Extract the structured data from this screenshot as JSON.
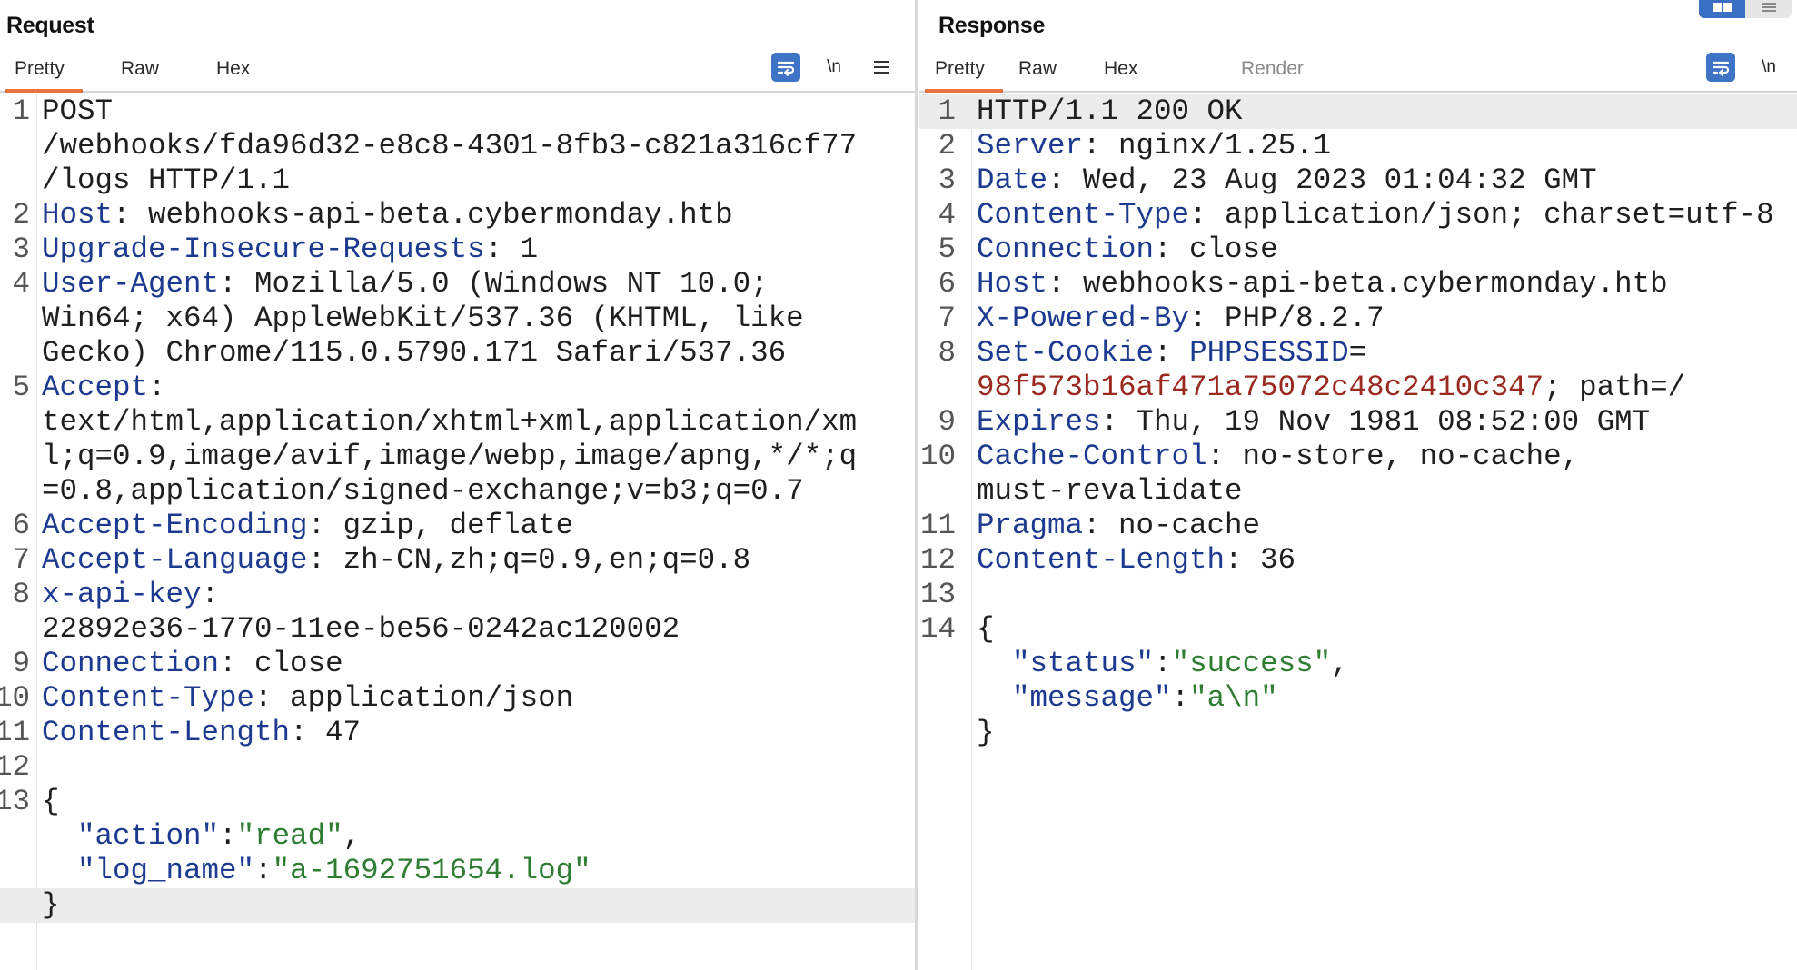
{
  "request": {
    "title": "Request",
    "tabs": [
      {
        "label": "Pretty",
        "active": true
      },
      {
        "label": "Raw",
        "active": false
      },
      {
        "label": "Hex",
        "active": false
      }
    ],
    "toolbar": {
      "wrap_icon": "word-wrap-icon",
      "newline_label": "\\n",
      "menu_icon": "hamburger-menu-icon"
    },
    "lines": [
      {
        "num": "1",
        "segs": [
          {
            "t": "POST",
            "c": "v"
          }
        ]
      },
      {
        "num": "",
        "segs": [
          {
            "t": "/webhooks/fda96d32-e8c8-4301-8fb3-c821a316cf77",
            "c": "v"
          }
        ]
      },
      {
        "num": "",
        "segs": [
          {
            "t": "/logs HTTP/1.1",
            "c": "v"
          }
        ]
      },
      {
        "num": "2",
        "segs": [
          {
            "t": "Host",
            "c": "k"
          },
          {
            "t": ": webhooks-api-beta.cybermonday.htb",
            "c": "v"
          }
        ]
      },
      {
        "num": "3",
        "segs": [
          {
            "t": "Upgrade-Insecure-Requests",
            "c": "k"
          },
          {
            "t": ": 1",
            "c": "v"
          }
        ]
      },
      {
        "num": "4",
        "segs": [
          {
            "t": "User-Agent",
            "c": "k"
          },
          {
            "t": ": Mozilla/5.0 (Windows NT 10.0;",
            "c": "v"
          }
        ]
      },
      {
        "num": "",
        "segs": [
          {
            "t": "Win64; x64) AppleWebKit/537.36 (KHTML, like",
            "c": "v"
          }
        ]
      },
      {
        "num": "",
        "segs": [
          {
            "t": "Gecko) Chrome/115.0.5790.171 Safari/537.36",
            "c": "v"
          }
        ]
      },
      {
        "num": "5",
        "segs": [
          {
            "t": "Accept",
            "c": "k"
          },
          {
            "t": ":",
            "c": "v"
          }
        ]
      },
      {
        "num": "",
        "segs": [
          {
            "t": "text/html,application/xhtml+xml,application/xm",
            "c": "v"
          }
        ]
      },
      {
        "num": "",
        "segs": [
          {
            "t": "l;q=0.9,image/avif,image/webp,image/apng,*/*;q",
            "c": "v"
          }
        ]
      },
      {
        "num": "",
        "segs": [
          {
            "t": "=0.8,application/signed-exchange;v=b3;q=0.7",
            "c": "v"
          }
        ]
      },
      {
        "num": "6",
        "segs": [
          {
            "t": "Accept-Encoding",
            "c": "k"
          },
          {
            "t": ": gzip, deflate",
            "c": "v"
          }
        ]
      },
      {
        "num": "7",
        "segs": [
          {
            "t": "Accept-Language",
            "c": "k"
          },
          {
            "t": ": zh-CN,zh;q=0.9,en;q=0.8",
            "c": "v"
          }
        ]
      },
      {
        "num": "8",
        "segs": [
          {
            "t": "x-api-key",
            "c": "k"
          },
          {
            "t": ":",
            "c": "v"
          }
        ]
      },
      {
        "num": "",
        "segs": [
          {
            "t": "22892e36-1770-11ee-be56-0242ac120002",
            "c": "v"
          }
        ]
      },
      {
        "num": "9",
        "segs": [
          {
            "t": "Connection",
            "c": "k"
          },
          {
            "t": ": close",
            "c": "v"
          }
        ]
      },
      {
        "num": "10",
        "segs": [
          {
            "t": "Content-Type",
            "c": "k"
          },
          {
            "t": ": application/json",
            "c": "v"
          }
        ]
      },
      {
        "num": "11",
        "segs": [
          {
            "t": "Content-Length",
            "c": "k"
          },
          {
            "t": ": 47",
            "c": "v"
          }
        ]
      },
      {
        "num": "12",
        "segs": []
      },
      {
        "num": "13",
        "segs": [
          {
            "t": "{",
            "c": "v"
          }
        ]
      },
      {
        "num": "",
        "segs": [
          {
            "t": "  \"action\"",
            "c": "k"
          },
          {
            "t": ":",
            "c": "v"
          },
          {
            "t": "\"read\"",
            "c": "s"
          },
          {
            "t": ",",
            "c": "v"
          }
        ]
      },
      {
        "num": "",
        "segs": [
          {
            "t": "  \"log_name\"",
            "c": "k"
          },
          {
            "t": ":",
            "c": "v"
          },
          {
            "t": "\"a-1692751654.log\"",
            "c": "s"
          }
        ]
      },
      {
        "num": "",
        "segs": [
          {
            "t": "}",
            "c": "v"
          }
        ],
        "highlight": true
      }
    ]
  },
  "response": {
    "title": "Response",
    "tabs": [
      {
        "label": "Pretty",
        "active": true
      },
      {
        "label": "Raw",
        "active": false
      },
      {
        "label": "Hex",
        "active": false
      },
      {
        "label": "Render",
        "active": false,
        "disabled": true
      }
    ],
    "toolbar": {
      "wrap_icon": "word-wrap-icon",
      "newline_label": "\\n"
    },
    "lines": [
      {
        "num": "1",
        "segs": [
          {
            "t": "HTTP/1.1 200 OK",
            "c": "v"
          }
        ],
        "highlight": true
      },
      {
        "num": "2",
        "segs": [
          {
            "t": "Server",
            "c": "k"
          },
          {
            "t": ": nginx/1.25.1",
            "c": "v"
          }
        ]
      },
      {
        "num": "3",
        "segs": [
          {
            "t": "Date",
            "c": "k"
          },
          {
            "t": ": Wed, 23 Aug 2023 01:04:32 GMT",
            "c": "v"
          }
        ]
      },
      {
        "num": "4",
        "segs": [
          {
            "t": "Content-Type",
            "c": "k"
          },
          {
            "t": ": application/json; charset=utf-8",
            "c": "v"
          }
        ]
      },
      {
        "num": "5",
        "segs": [
          {
            "t": "Connection",
            "c": "k"
          },
          {
            "t": ": close",
            "c": "v"
          }
        ]
      },
      {
        "num": "6",
        "segs": [
          {
            "t": "Host",
            "c": "k"
          },
          {
            "t": ": webhooks-api-beta.cybermonday.htb",
            "c": "v"
          }
        ]
      },
      {
        "num": "7",
        "segs": [
          {
            "t": "X-Powered-By",
            "c": "k"
          },
          {
            "t": ": PHP/8.2.7",
            "c": "v"
          }
        ]
      },
      {
        "num": "8",
        "segs": [
          {
            "t": "Set-Cookie",
            "c": "k"
          },
          {
            "t": ": ",
            "c": "v"
          },
          {
            "t": "PHPSESSID",
            "c": "k"
          },
          {
            "t": "=",
            "c": "v"
          }
        ]
      },
      {
        "num": "",
        "segs": [
          {
            "t": "98f573b16af471a75072c48c2410c347",
            "c": "c"
          },
          {
            "t": "; path=/",
            "c": "v"
          }
        ]
      },
      {
        "num": "9",
        "segs": [
          {
            "t": "Expires",
            "c": "k"
          },
          {
            "t": ": Thu, 19 Nov 1981 08:52:00 GMT",
            "c": "v"
          }
        ]
      },
      {
        "num": "10",
        "segs": [
          {
            "t": "Cache-Control",
            "c": "k"
          },
          {
            "t": ": no-store, no-cache,",
            "c": "v"
          }
        ]
      },
      {
        "num": "",
        "segs": [
          {
            "t": "must-revalidate",
            "c": "v"
          }
        ]
      },
      {
        "num": "11",
        "segs": [
          {
            "t": "Pragma",
            "c": "k"
          },
          {
            "t": ": no-cache",
            "c": "v"
          }
        ]
      },
      {
        "num": "12",
        "segs": [
          {
            "t": "Content-Length",
            "c": "k"
          },
          {
            "t": ": 36",
            "c": "v"
          }
        ]
      },
      {
        "num": "13",
        "segs": []
      },
      {
        "num": "14",
        "segs": [
          {
            "t": "{",
            "c": "v"
          }
        ]
      },
      {
        "num": "",
        "segs": [
          {
            "t": "  \"status\"",
            "c": "k"
          },
          {
            "t": ":",
            "c": "v"
          },
          {
            "t": "\"success\"",
            "c": "s"
          },
          {
            "t": ",",
            "c": "v"
          }
        ]
      },
      {
        "num": "",
        "segs": [
          {
            "t": "  \"message\"",
            "c": "k"
          },
          {
            "t": ":",
            "c": "v"
          },
          {
            "t": "\"a\\n\"",
            "c": "s"
          }
        ]
      },
      {
        "num": "",
        "segs": [
          {
            "t": "}",
            "c": "v"
          }
        ]
      }
    ]
  },
  "layout_toggle": {
    "icons": [
      "split-view-icon",
      "stacked-view-icon"
    ],
    "active": "split-view-icon"
  },
  "colors": {
    "header_key": "#1c3a8f",
    "value_text": "#1f1f1f",
    "json_string": "#2e7d32",
    "cookie_value": "#9a2a1f",
    "active_tab_underline": "#e8743b",
    "accent_button": "#3f73c6"
  }
}
